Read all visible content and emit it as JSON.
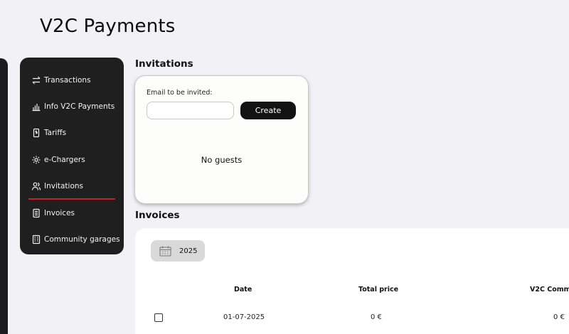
{
  "page": {
    "title": "V2C Payments"
  },
  "sidebar": {
    "items": [
      {
        "label": "Transactions",
        "icon": "transfer-arrows-icon"
      },
      {
        "label": "Info V2C Payments",
        "icon": "bar-chart-icon"
      },
      {
        "label": "Tariffs",
        "icon": "tariff-card-icon"
      },
      {
        "label": "e-Chargers",
        "icon": "gear-icon"
      },
      {
        "label": "Invitations",
        "icon": "users-icon",
        "active": true
      },
      {
        "label": "Invoices",
        "icon": "document-icon"
      },
      {
        "label": "Community garages",
        "icon": "building-icon"
      }
    ],
    "active_color": "#c41f1f"
  },
  "invitations": {
    "title": "Invitations",
    "email_label": "Email to be invited:",
    "email_value": "",
    "create_label": "Create",
    "empty_text": "No guests"
  },
  "invoices": {
    "title": "Invoices",
    "year": "2025",
    "columns": [
      "Date",
      "Total price",
      "V2C Comm"
    ],
    "rows": [
      {
        "date": "01-07-2025",
        "total_price": "0 €",
        "v2c_comm": "0 €"
      }
    ]
  }
}
